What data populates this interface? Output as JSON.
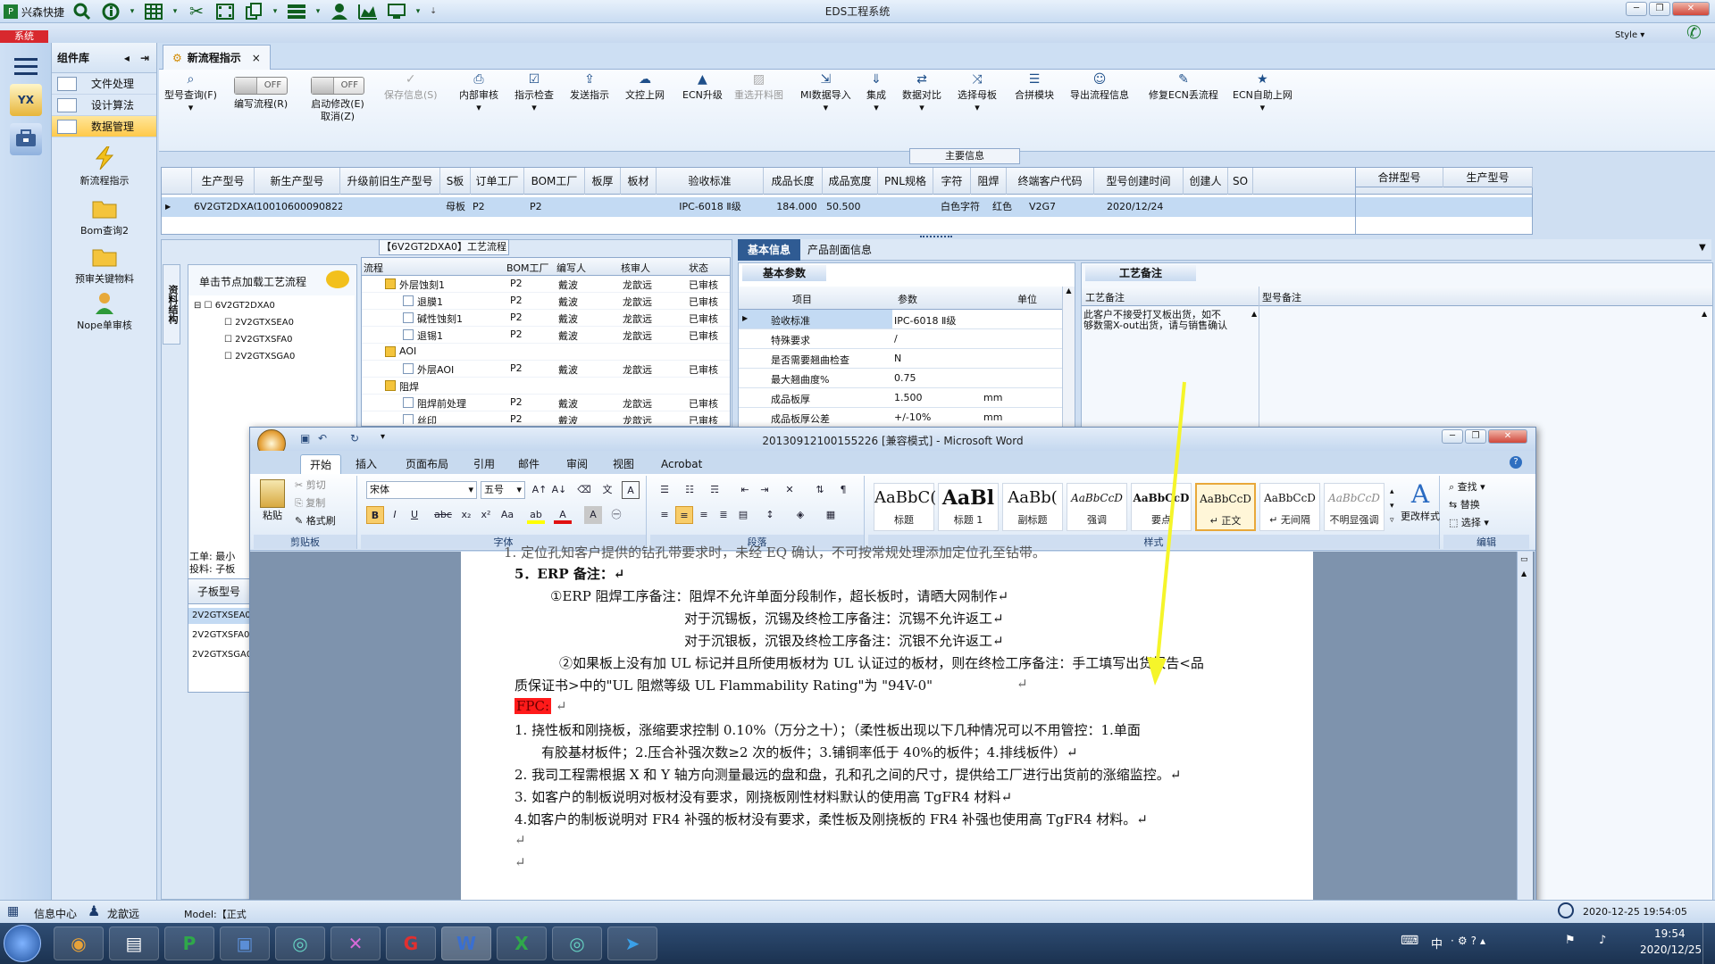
{
  "app": {
    "quick_launch": "兴森快捷",
    "title": "EDS工程系统",
    "style_label": "Style",
    "system_tab": "系统"
  },
  "left_strip": {
    "yx_label": "YX"
  },
  "component": {
    "header": "组件库",
    "menu": [
      {
        "label": "文件处理",
        "selected": false
      },
      {
        "label": "设计算法",
        "selected": false
      },
      {
        "label": "数据管理",
        "selected": true
      }
    ],
    "big_icons": [
      {
        "label": "新流程指示",
        "icon": "lightning-icon"
      },
      {
        "label": "Bom查询2",
        "icon": "folder-icon"
      },
      {
        "label": "预审关键物料",
        "icon": "folder-icon"
      },
      {
        "label": "Nope单审核",
        "icon": "user-icon"
      }
    ]
  },
  "doc_tab": {
    "label": "新流程指示",
    "close": "×"
  },
  "ribbon": {
    "buttons": [
      {
        "label": "型号查询(F)",
        "icon": "search-icon",
        "dropdown": "▾"
      },
      {
        "label": "编写流程(R)",
        "toggle": "OFF"
      },
      {
        "label": "启动修改(E)",
        "toggle": "OFF",
        "sub": "取消(Z)"
      },
      {
        "label": "保存信息(S)",
        "icon": "check-icon",
        "disabled": true
      },
      {
        "label": "内部审核",
        "icon": "print-icon",
        "dropdown": "▾"
      },
      {
        "label": "指示检查",
        "icon": "check-icon",
        "dropdown": "▾"
      },
      {
        "label": "发送指示",
        "icon": "upload-icon"
      },
      {
        "label": "文控上网",
        "icon": "cloud-icon"
      },
      {
        "label": "ECN升级",
        "icon": "ecn-icon"
      },
      {
        "label": "重选开料图",
        "icon": "image-icon",
        "disabled": true
      },
      {
        "label": "MI数据导入",
        "icon": "import-icon",
        "dropdown": "▾"
      },
      {
        "label": "集成",
        "icon": "download-icon",
        "dropdown": "▾"
      },
      {
        "label": "数据对比",
        "icon": "compare-icon",
        "dropdown": "▾"
      },
      {
        "label": "选择母板",
        "icon": "shuffle-icon",
        "dropdown": "▾"
      },
      {
        "label": "合拼模块",
        "icon": "list-icon"
      },
      {
        "label": "导出流程信息",
        "icon": "export-icon"
      },
      {
        "label": "修复ECN丢流程",
        "icon": "wrench-icon"
      },
      {
        "label": "ECN自助上网",
        "icon": "star-icon",
        "dropdown": "▾"
      }
    ]
  },
  "main_info": {
    "caption": "主要信息",
    "columns": [
      "生产型号",
      "新生产型号",
      "升级前旧生产型号",
      "S板",
      "订单工厂",
      "BOM工厂",
      "板厚",
      "板材",
      "验收标准",
      "成品长度",
      "成品宽度",
      "PNL规格",
      "字符",
      "阻焊",
      "终端客户代码",
      "型号创建时间",
      "创建人",
      "SO"
    ],
    "row": [
      "6V2GT2DXA0",
      "10010600090822",
      "",
      "母板",
      "P2",
      "P2",
      "",
      "",
      "IPC-6018 Ⅱ级",
      "184.000",
      "50.500",
      "",
      "白色字符",
      "红色",
      "V2G7",
      "2020/12/24",
      "",
      ""
    ],
    "right_columns": [
      "合拼型号",
      "生产型号"
    ]
  },
  "process": {
    "title": "【6V2GT2DXA0】工艺流程",
    "side_label": "资料结构",
    "load_hint": "单击节点加载工艺流程",
    "tree": [
      "6V2GT2DXA0",
      "2V2GTXSEA0",
      "2V2GTXSFA0",
      "2V2GTXSGA0"
    ],
    "columns": [
      "流程",
      "BOM工厂",
      "编写人",
      "核审人",
      "状态"
    ],
    "rows": [
      {
        "name": "外层蚀刻1",
        "level": 1,
        "bom": "P2",
        "writer": "戴波",
        "checker": "龙歆远",
        "status": "已审核"
      },
      {
        "name": "退膜1",
        "level": 2,
        "bom": "P2",
        "writer": "戴波",
        "checker": "龙歆远",
        "status": "已审核"
      },
      {
        "name": "碱性蚀刻1",
        "level": 2,
        "bom": "P2",
        "writer": "戴波",
        "checker": "龙歆远",
        "status": "已审核"
      },
      {
        "name": "退锡1",
        "level": 2,
        "bom": "P2",
        "writer": "戴波",
        "checker": "龙歆远",
        "status": "已审核"
      },
      {
        "name": "AOI",
        "level": 1,
        "bom": "",
        "writer": "",
        "checker": "",
        "status": ""
      },
      {
        "name": "外层AOI",
        "level": 2,
        "bom": "P2",
        "writer": "戴波",
        "checker": "龙歆远",
        "status": "已审核"
      },
      {
        "name": "阻焊",
        "level": 1,
        "bom": "",
        "writer": "",
        "checker": "",
        "status": ""
      },
      {
        "name": "阻焊前处理",
        "level": 2,
        "bom": "P2",
        "writer": "戴波",
        "checker": "龙歆远",
        "status": "已审核"
      },
      {
        "name": "丝印",
        "level": 2,
        "bom": "P2",
        "writer": "戴波",
        "checker": "龙歆远",
        "status": "已审核"
      }
    ],
    "work_label": "工单: 最小",
    "feed_label": "投料: 子板",
    "sub_header": "子板型号",
    "sub_rows": [
      "2V2GTXSEA0",
      "2V2GTXSFA0",
      "2V2GTXSGA0"
    ]
  },
  "basic": {
    "tabs": [
      "基本信息",
      "产品剖面信息"
    ],
    "section": "基本参数",
    "columns": [
      "项目",
      "参数",
      "单位"
    ],
    "rows": [
      {
        "item": "验收标准",
        "value": "IPC-6018 Ⅱ级",
        "unit": ""
      },
      {
        "item": "特殊要求",
        "value": "/",
        "unit": ""
      },
      {
        "item": "是否需要翘曲检查",
        "value": "N",
        "unit": ""
      },
      {
        "item": "最大翘曲度%",
        "value": "0.75",
        "unit": ""
      },
      {
        "item": "成品板厚",
        "value": "1.500",
        "unit": "mm"
      },
      {
        "item": "成品板厚公差",
        "value": "+/-10%",
        "unit": "mm"
      }
    ]
  },
  "craft": {
    "section": "工艺备注",
    "col1": "工艺备注",
    "col2": "型号备注",
    "note1": "此客户不接受打叉板出货，如不",
    "note2": "够数需X-out出货，请与销售确认"
  },
  "word": {
    "title": "20130912100155226 [兼容模式] - Microsoft Word",
    "tabs": [
      "开始",
      "插入",
      "页面布局",
      "引用",
      "邮件",
      "审阅",
      "视图",
      "Acrobat"
    ],
    "clipboard": {
      "paste": "粘贴",
      "cut": "剪切",
      "copy": "复制",
      "format": "格式刷",
      "label": "剪贴板"
    },
    "font": {
      "name": "宋体",
      "size": "五号",
      "label": "字体"
    },
    "paragraph_label": "段落",
    "styles_label": "样式",
    "styles": [
      {
        "preview": "AaBbC(",
        "name": "标题"
      },
      {
        "preview": "AaBl",
        "name": "标题 1"
      },
      {
        "preview": "AaBb(",
        "name": "副标题"
      },
      {
        "preview": "AaBbCcD",
        "name": "强调"
      },
      {
        "preview": "AaBbCcD",
        "name": "要点"
      },
      {
        "preview": "AaBbCcD",
        "name": "↵ 正文",
        "selected": true
      },
      {
        "preview": "AaBbCcD",
        "name": "↵ 无间隔"
      },
      {
        "preview": "AaBbCcD",
        "name": "不明显强调"
      }
    ],
    "change_styles": "更改样式",
    "editing": {
      "find": "查找 ▾",
      "replace": "替换",
      "select": "选择 ▾",
      "label": "编辑"
    },
    "doc": {
      "top_clip": "1. 定位孔知客户提供的钻孔带要求时，未经 EQ 确认，不可按常规处理添加定位孔至钻带。",
      "l1": "5．ERP 备注：↵",
      "l2": "①ERP 阻焊工序备注：阻焊不允许单面分段制作，超长板时，请晒大网制作↵",
      "l3": "对于沉锡板，沉锡及终检工序备注：沉锡不允许返工↵",
      "l4": "对于沉银板，沉银及终检工序备注：沉银不允许返工↵",
      "l5": "②如果板上没有加 UL 标记并且所使用板材为 UL 认证过的板材，则在终检工序备注：手工填写出货报告<品",
      "l6": "质保证书>中的\"UL 阻燃等级 UL Flammability Rating\"为 \"94V-0\"",
      "l6b": "↵",
      "fpc": "FPC:",
      "fpc_mark": "↵",
      "l8": "1.  挠性板和刚挠板，涨缩要求控制  0.10%（万分之十）；（柔性板出现以下几种情况可以不用管控：1.单面",
      "l9": "有胶基材板件；2.压合补强次数≥2 次的板件；3.铺铜率低于 40%的板件；4.排线板件）↵",
      "l10": "2.   我司工程需根据 X 和 Y 轴方向测量最远的盘和盘，孔和孔之间的尺寸，提供给工厂进行出货前的涨缩监控。↵",
      "l11": "3. 如客户的制板说明对板材没有要求，刚挠板刚性材料默认的使用高 TgFR4 材料↵",
      "l12": "4.如客户的制板说明对 FR4 补强的板材没有要求，柔性板及刚挠板的 FR4 补强也使用高 TgFR4 材料。↵",
      "l13": "↵",
      "l14": "↵"
    }
  },
  "status": {
    "info_center": "信息中心",
    "user": "龙歆远",
    "model": "Model:【正式",
    "datetime": "2020-12-25 19:54:05"
  },
  "taskbar": {
    "apps": [
      "explorer",
      "notepad",
      "eds",
      "save",
      "eye",
      "tool",
      "red",
      "word",
      "excel",
      "eye2",
      "send"
    ],
    "ime": "中",
    "time": "19:54",
    "date": "2020/12/25"
  },
  "colors": {
    "accent": "#ffc94a",
    "highlight_red": "#ff1a1a",
    "arrow": "#f5f52a",
    "selection": "#c3daf3"
  }
}
